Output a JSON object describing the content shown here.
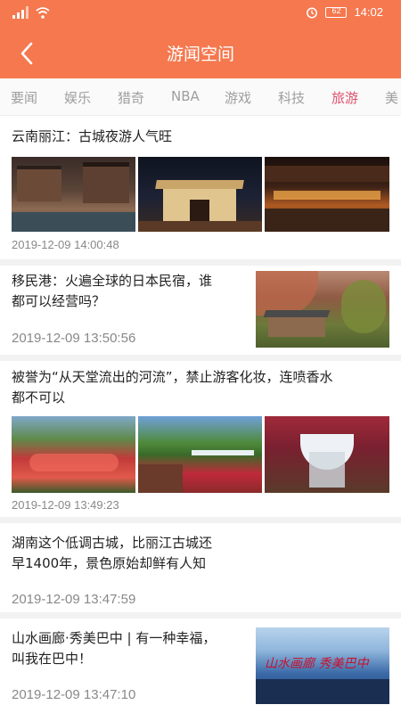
{
  "status_bar": {
    "signal": "signal-icon",
    "wifi": "wifi-icon",
    "alarm": "alarm-icon",
    "battery_label": "62",
    "time": "14:02"
  },
  "header": {
    "title": "游闻空间",
    "back_icon": "back-arrow-icon"
  },
  "tabs": [
    {
      "label": "要闻"
    },
    {
      "label": "娱乐"
    },
    {
      "label": "猎奇"
    },
    {
      "label": "NBA"
    },
    {
      "label": "游戏"
    },
    {
      "label": "科技"
    },
    {
      "label": "旅游",
      "active": true
    },
    {
      "label": "美"
    }
  ],
  "articles": [
    {
      "title": "云南丽江：古城夜游人气旺",
      "time": "2019-12-09 14:00:48",
      "layout": "three-images"
    },
    {
      "title_line1": "移民港：火遍全球的日本民宿，谁",
      "title_line2": "都可以经营吗？",
      "time": "2019-12-09 13:50:56",
      "layout": "right-image"
    },
    {
      "title_line1": "被誉为“从天堂流出的河流”，禁止游客化妆，连喷香水",
      "title_line2": "都不可以",
      "time": "2019-12-09 13:49:23",
      "layout": "three-images"
    },
    {
      "title_line1": "湖南这个低调古城，比丽江古城还",
      "title_line2": "早1400年，景色原始却鲜有人知",
      "time": "2019-12-09 13:47:59",
      "layout": "text-only"
    },
    {
      "title_line1": "山水画廊·秀美巴中 | 有一种幸福，",
      "title_line2": "叫我在巴中！",
      "time": "2019-12-09 13:47:10",
      "layout": "right-image",
      "image_text": "山水画廊 秀美巴中"
    }
  ],
  "colors": {
    "accent": "#f5784f",
    "active_tab": "#e0506b",
    "tab_text": "#9e9e9e",
    "time_text": "#888888"
  }
}
